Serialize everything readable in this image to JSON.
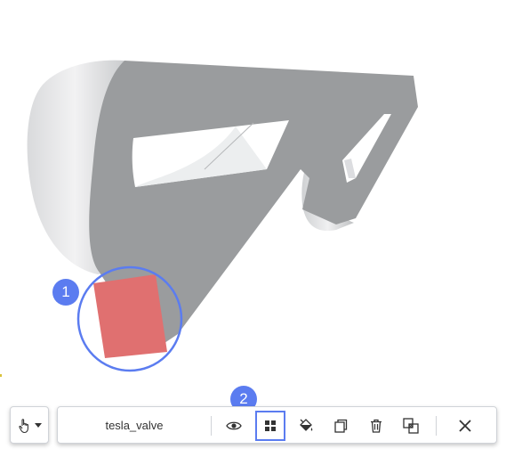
{
  "callouts": [
    {
      "number": "1"
    },
    {
      "number": "2"
    }
  ],
  "model": {
    "body_color": "#9a9c9e",
    "highlight_color": "#e07070",
    "circle_color": "#5b7cf0"
  },
  "toolbar": {
    "hand_tool": {
      "icon": "hand-pointer-icon",
      "dropdown_icon": "caret-down-icon"
    },
    "object_name": "tesla_valve",
    "buttons": [
      {
        "icon": "eye-icon",
        "action": "visibility"
      },
      {
        "icon": "grid-icon",
        "action": "select-faces",
        "active": true
      },
      {
        "icon": "paint-bucket-icon",
        "action": "appearance"
      },
      {
        "icon": "copy-icon",
        "action": "copy"
      },
      {
        "icon": "trash-icon",
        "action": "delete"
      },
      {
        "icon": "intersect-icon",
        "action": "boolean"
      },
      {
        "icon": "close-icon",
        "action": "close"
      }
    ]
  }
}
